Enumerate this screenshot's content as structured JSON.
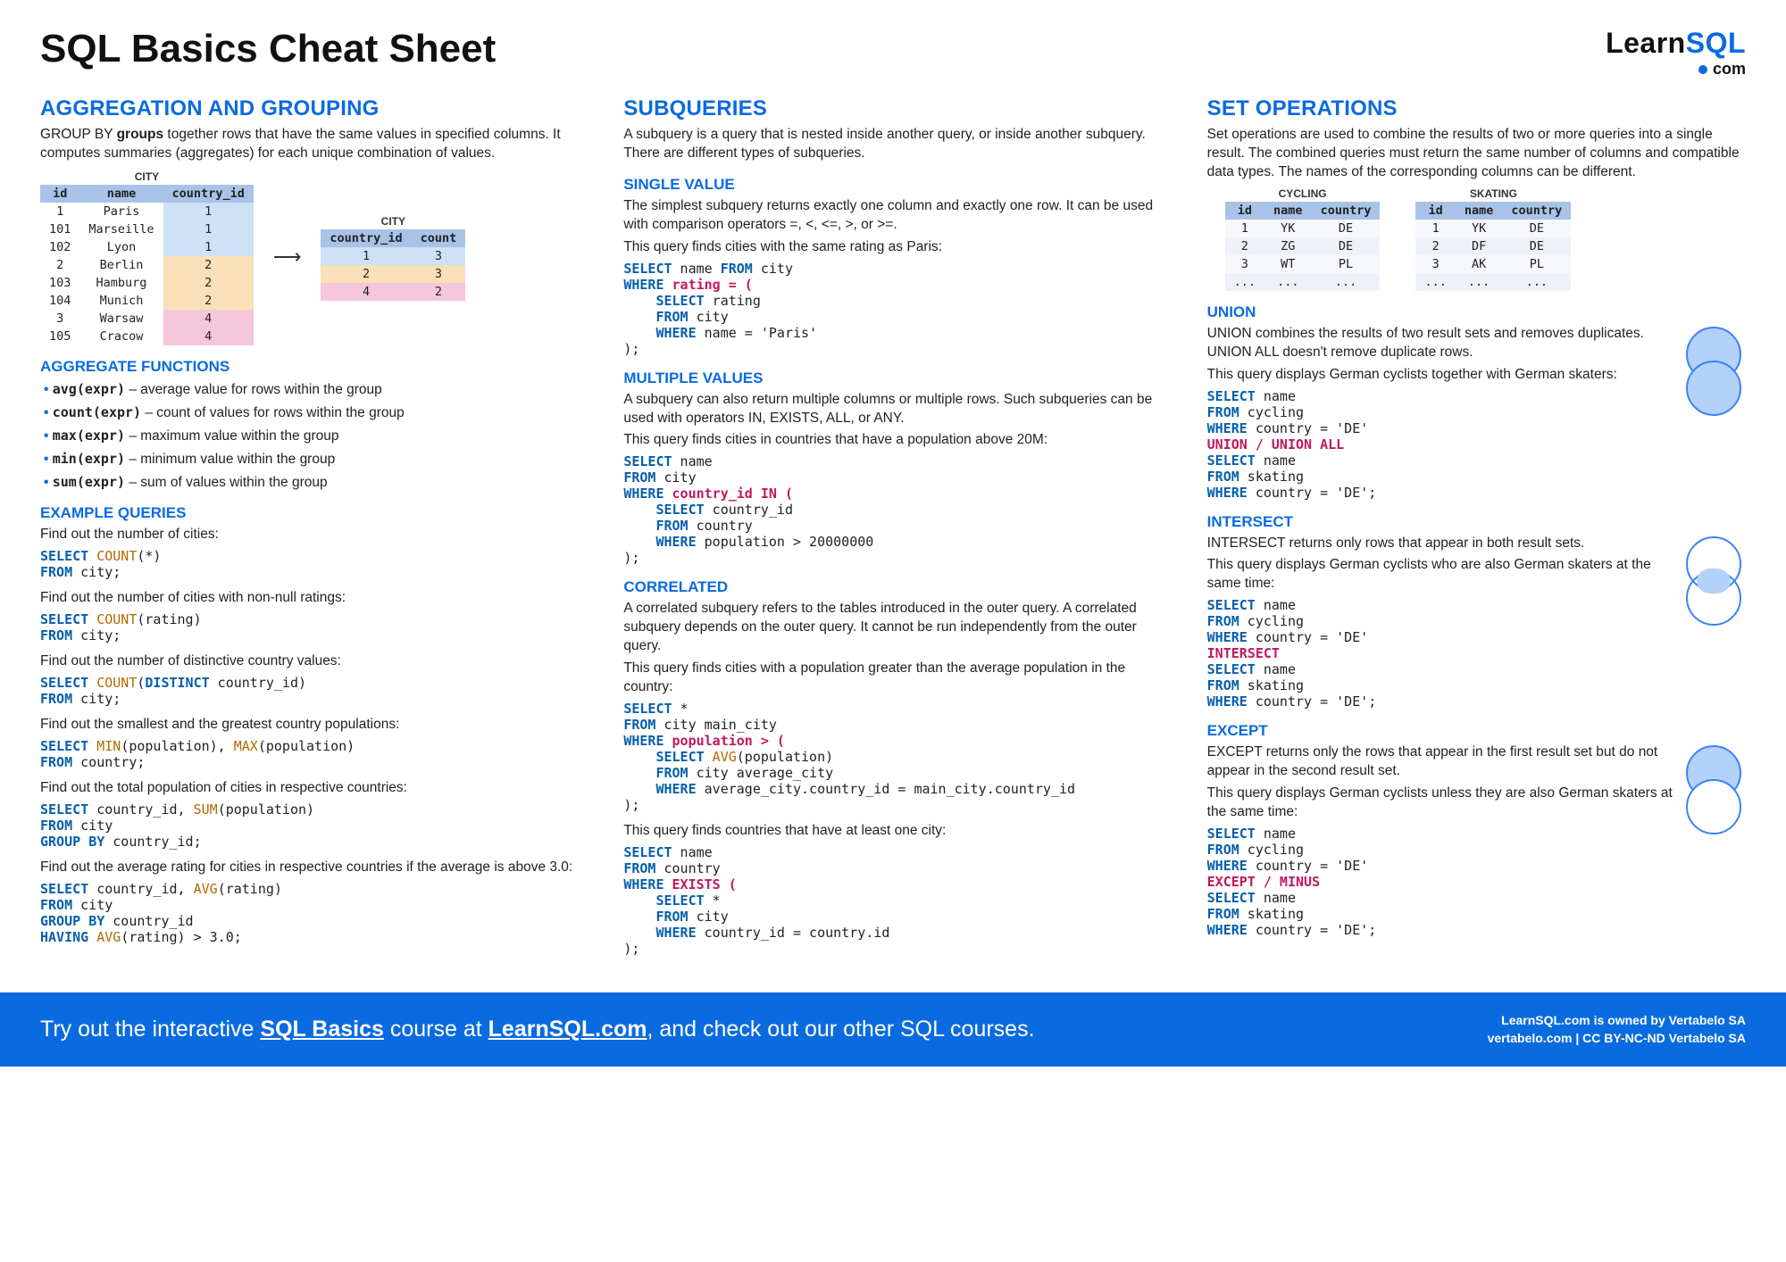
{
  "title": "SQL Basics Cheat Sheet",
  "logo": {
    "learn": "Learn",
    "sql": "SQL",
    "com": "com"
  },
  "col1": {
    "h": "AGGREGATION AND GROUPING",
    "intro1": "GROUP BY ",
    "intro1b": "groups",
    "intro1c": " together rows that have the same values in specified columns. It computes summaries (aggregates) for each unique combination of values.",
    "city_table": {
      "cap": "CITY",
      "head": [
        "id",
        "name",
        "country_id"
      ],
      "rows": [
        [
          "1",
          "Paris",
          "1",
          "c1"
        ],
        [
          "101",
          "Marseille",
          "1",
          "c1"
        ],
        [
          "102",
          "Lyon",
          "1",
          "c1"
        ],
        [
          "2",
          "Berlin",
          "2",
          "c2"
        ],
        [
          "103",
          "Hamburg",
          "2",
          "c2"
        ],
        [
          "104",
          "Munich",
          "2",
          "c2"
        ],
        [
          "3",
          "Warsaw",
          "4",
          "c4"
        ],
        [
          "105",
          "Cracow",
          "4",
          "c4"
        ]
      ]
    },
    "agg_table": {
      "cap": "CITY",
      "head": [
        "country_id",
        "count"
      ],
      "rows": [
        [
          "1",
          "3",
          "c1"
        ],
        [
          "2",
          "3",
          "c2"
        ],
        [
          "4",
          "2",
          "c4"
        ]
      ]
    },
    "aggfn_h": "AGGREGATE FUNCTIONS",
    "aggfns": [
      [
        "avg(expr)",
        " – average value for rows within the group"
      ],
      [
        "count(expr)",
        " – count of values for rows within the group"
      ],
      [
        "max(expr)",
        " – maximum value within the group"
      ],
      [
        "min(expr)",
        " – minimum value within the group"
      ],
      [
        "sum(expr)",
        " – sum of values within the group"
      ]
    ],
    "ex_h": "EXAMPLE QUERIES",
    "ex": [
      [
        "Find out the number of cities:",
        "SELECT COUNT(*)\nFROM city;"
      ],
      [
        "Find out the number of cities with non-null ratings:",
        "SELECT COUNT(rating)\nFROM city;"
      ],
      [
        "Find out the number of distinctive country values:",
        "SELECT COUNT(DISTINCT country_id)\nFROM city;"
      ],
      [
        "Find out the smallest and the greatest country populations:",
        "SELECT MIN(population), MAX(population)\nFROM country;"
      ],
      [
        "Find out the total population of cities in respective countries:",
        "SELECT country_id, SUM(population)\nFROM city\nGROUP BY country_id;"
      ],
      [
        "Find out the average rating for cities in respective countries if the average is above 3.0:",
        "SELECT country_id, AVG(rating)\nFROM city\nGROUP BY country_id\nHAVING AVG(rating) > 3.0;"
      ]
    ]
  },
  "col2": {
    "h": "SUBQUERIES",
    "intro": "A subquery is a query that is nested inside another query, or inside another subquery. There are different types of subqueries.",
    "sv_h": "SINGLE VALUE",
    "sv_p": "The simplest subquery returns exactly one column and exactly one row. It can be used with comparison operators =, <, <=, >, or >=.",
    "sv_l": "This query finds cities with the same rating as Paris:",
    "sv_code": "SELECT name FROM city\nWHERE rating = (\n    SELECT rating\n    FROM city\n    WHERE name = 'Paris'\n);",
    "mv_h": "MULTIPLE VALUES",
    "mv_p": "A subquery can also return multiple columns or multiple rows. Such subqueries can be used with operators IN, EXISTS, ALL, or ANY.",
    "mv_l": "This query finds cities in countries that have a population above 20M:",
    "mv_code": "SELECT name\nFROM city\nWHERE country_id IN (\n    SELECT country_id\n    FROM country\n    WHERE population > 20000000\n);",
    "co_h": "CORRELATED",
    "co_p": "A correlated subquery refers to the tables introduced in the outer query. A correlated subquery depends on the outer query. It cannot be run independently from the outer query.",
    "co_l1": "This query finds cities with a population greater than the average population in the country:",
    "co_code1": "SELECT *\nFROM city main_city\nWHERE population > (\n    SELECT AVG(population)\n    FROM city average_city\n    WHERE average_city.country_id = main_city.country_id\n);",
    "co_l2": "This query finds countries that have at least one city:",
    "co_code2": "SELECT name\nFROM country\nWHERE EXISTS (\n    SELECT *\n    FROM city\n    WHERE country_id = country.id\n);"
  },
  "col3": {
    "h": "SET OPERATIONS",
    "intro": "Set operations are used to combine the results of two or more queries into a single result. The combined queries must return the same number of columns and compatible data types. The names of the corresponding columns can be different.",
    "cycling": {
      "cap": "CYCLING",
      "head": [
        "id",
        "name",
        "country"
      ],
      "rows": [
        [
          "1",
          "YK",
          "DE"
        ],
        [
          "2",
          "ZG",
          "DE"
        ],
        [
          "3",
          "WT",
          "PL"
        ],
        [
          "...",
          "...",
          "..."
        ]
      ]
    },
    "skating": {
      "cap": "SKATING",
      "head": [
        "id",
        "name",
        "country"
      ],
      "rows": [
        [
          "1",
          "YK",
          "DE"
        ],
        [
          "2",
          "DF",
          "DE"
        ],
        [
          "3",
          "AK",
          "PL"
        ],
        [
          "...",
          "...",
          "..."
        ]
      ]
    },
    "union_h": "UNION",
    "union_p": "UNION combines the results of two result sets and removes duplicates. UNION ALL doesn't remove duplicate rows.",
    "union_l": "This query displays German cyclists together with German skaters:",
    "union_code": "SELECT name\nFROM cycling\nWHERE country = 'DE'\nUNION / UNION ALL\nSELECT name\nFROM skating\nWHERE country = 'DE';",
    "inter_h": "INTERSECT",
    "inter_p": "INTERSECT returns only rows that appear in both result sets.",
    "inter_l": "This query displays German cyclists who are also German skaters at the same time:",
    "inter_code": "SELECT name\nFROM cycling\nWHERE country = 'DE'\nINTERSECT\nSELECT name\nFROM skating\nWHERE country = 'DE';",
    "except_h": "EXCEPT",
    "except_p": "EXCEPT returns only the rows that appear in the first result set but do not appear in the second result set.",
    "except_l": "This query displays German cyclists unless they are also German skaters at the same time:",
    "except_code": "SELECT name\nFROM cycling\nWHERE country = 'DE'\nEXCEPT / MINUS\nSELECT name\nFROM skating\nWHERE country = 'DE';"
  },
  "footer": {
    "try": "Try out the interactive ",
    "course": "SQL Basics",
    "at": " course at ",
    "site": "LearnSQL.com",
    "rest": ", and check out our other SQL courses.",
    "r1": "LearnSQL.com is owned by Vertabelo SA",
    "r2": "vertabelo.com | CC BY-NC-ND Vertabelo SA"
  }
}
